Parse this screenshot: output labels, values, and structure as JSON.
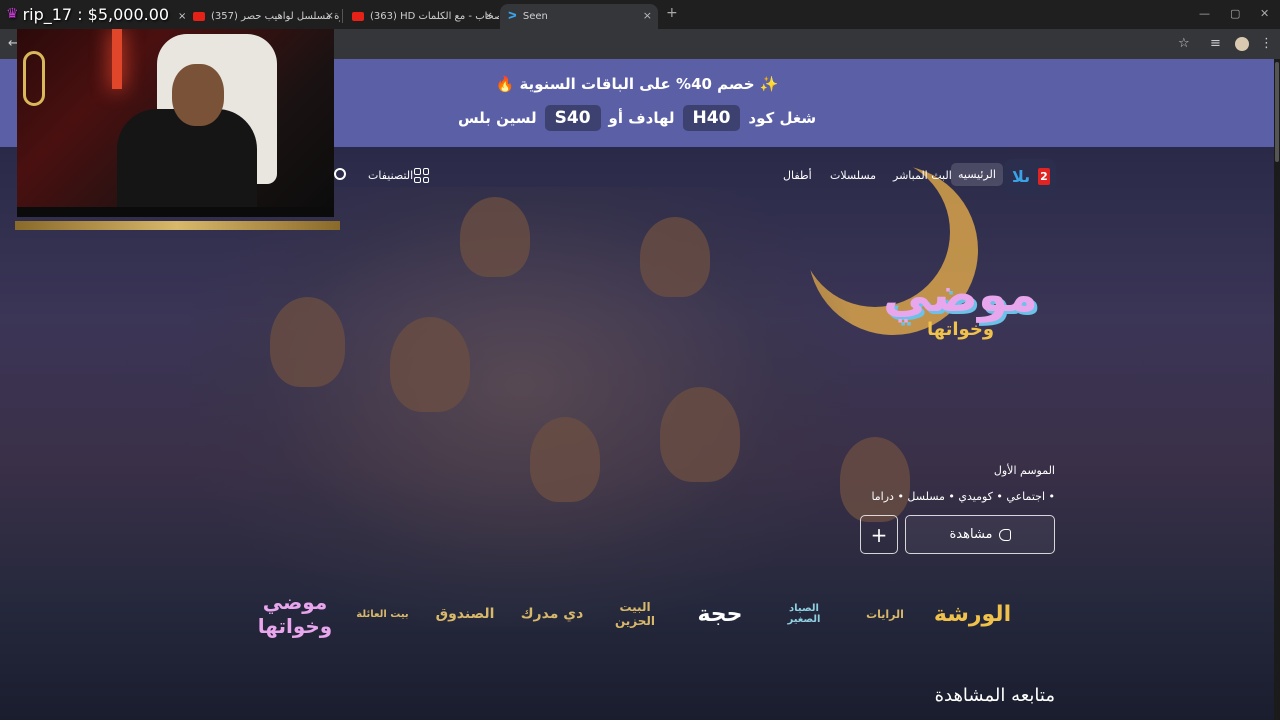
{
  "browser": {
    "tabs": [
      {
        "label": "شارة مسلسل لواهيب حصر...",
        "close": "×"
      },
      {
        "label": "(357) شارة مسلسل لواهيب حصر",
        "close": "×"
      },
      {
        "label": "(363) HD الأصحاب - مع الكلمات",
        "close": "×"
      },
      {
        "label": "Seen",
        "close": "×"
      }
    ],
    "new_tab": "+",
    "window_controls": [
      "—",
      "▢",
      "✕"
    ]
  },
  "overlay": {
    "donation_text": "rip_17 : $5,000.00"
  },
  "promo": {
    "line1": "✨ خصم 40% على الباقات السنوية 🔥",
    "line2_prefix": "شغل كود",
    "code1": "H40",
    "line2_mid": "لهادف أو",
    "code2": "S40",
    "line2_suffix": "لسين بلس"
  },
  "nav": {
    "logo_number": "2",
    "logo_mark": "ىلا",
    "home": "الرئيسيه",
    "live": "البث المباشر",
    "series": "مسلسلات",
    "kids": "أطفال",
    "categories": "التصنيفات"
  },
  "hero": {
    "show_title": "موضي",
    "show_subtitle": "وخواتها",
    "season": "الموسم الأول",
    "genres": "• اجتماعي • كوميدي • مسلسل • دراما",
    "watch_label": "مشاهدة",
    "add_label": "+"
  },
  "shows": [
    {
      "name": "موضي وخواتها",
      "color": "#e8a6ec"
    },
    {
      "name": "بيت العائلة",
      "color": "#d8b86a"
    },
    {
      "name": "الصندوق",
      "color": "#d8b86a"
    },
    {
      "name": "دي مدرك",
      "color": "#d8b86a"
    },
    {
      "name": "البيت الحزين",
      "color": "#d8b86a"
    },
    {
      "name": "حجة",
      "color": "#ffffff"
    },
    {
      "name": "الصياد الصغير",
      "color": "#8fd0e0"
    },
    {
      "name": "الرايات",
      "color": "#d8b86a"
    },
    {
      "name": "الورشة",
      "color": "#f0c24b"
    }
  ],
  "sections": {
    "continue_watching": "متابعه المشاهدة"
  }
}
